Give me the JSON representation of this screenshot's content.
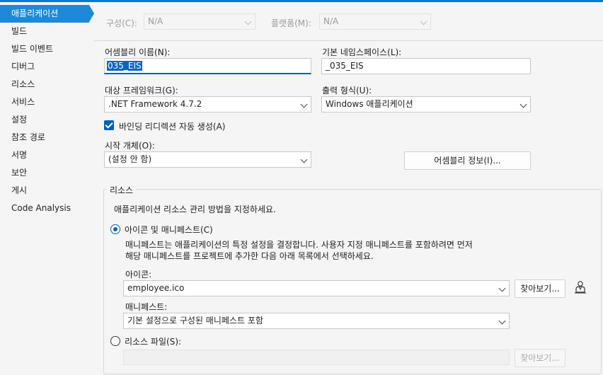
{
  "sidebar": {
    "items": [
      {
        "label": "애플리케이션"
      },
      {
        "label": "빌드"
      },
      {
        "label": "빌드 이벤트"
      },
      {
        "label": "디버그"
      },
      {
        "label": "리소스"
      },
      {
        "label": "서비스"
      },
      {
        "label": "설정"
      },
      {
        "label": "참조 경로"
      },
      {
        "label": "서명"
      },
      {
        "label": "보안"
      },
      {
        "label": "게시"
      },
      {
        "label": "Code Analysis"
      }
    ]
  },
  "config": {
    "config_label": "구성(C):",
    "config_value": "N/A",
    "platform_label": "플랫폼(M):",
    "platform_value": "N/A"
  },
  "application": {
    "assembly_name_label": "어셈블리 이름(N):",
    "assembly_name_value": "035_EIS",
    "default_namespace_label": "기본 네임스페이스(L):",
    "default_namespace_value": "_035_EIS",
    "target_framework_label": "대상 프레임워크(G):",
    "target_framework_value": ".NET Framework 4.7.2",
    "output_type_label": "출력 형식(U):",
    "output_type_value": "Windows 애플리케이션",
    "binding_redirect_label": "바인딩 리디렉션 자동 생성(A)",
    "startup_object_label": "시작 개체(O):",
    "startup_object_value": "(설정 안 함)",
    "assembly_info_button": "어셈블리 정보(I)..."
  },
  "resources": {
    "group_title": "리소스",
    "description": "애플리케이션 리소스 관리 방법을 지정하세요.",
    "icon_manifest_option": "아이콘 및 매니페스트(C)",
    "icon_manifest_desc_line1": "매니페스트는 애플리케이션의 특정 설정을 결정합니다. 사용자 지정 매니페스트를 포함하려면 먼저",
    "icon_manifest_desc_line2": "해당 매니페스트를 프로젝트에 추가한 다음 아래 목록에서 선택하세요.",
    "icon_label": "아이콘:",
    "icon_value": "employee.ico",
    "browse_button": "찾아보기...",
    "manifest_label": "매니페스트:",
    "manifest_value": "기본 설정으로 구성된 매니페스트 포함",
    "resource_file_option": "리소스 파일(S):",
    "resource_browse_button": "찾아보기..."
  },
  "colors": {
    "accent": "#1c8ad8",
    "focus": "#005fb8"
  }
}
